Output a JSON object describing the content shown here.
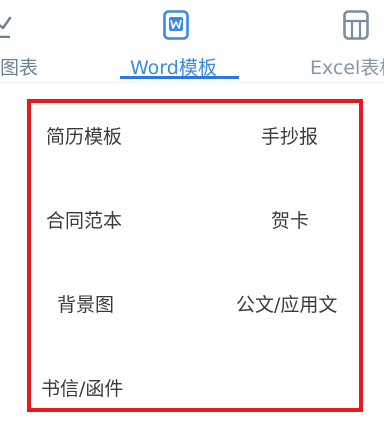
{
  "tabs": [
    {
      "id": "chart",
      "label": "图表",
      "icon": "chart-icon",
      "active": false
    },
    {
      "id": "word",
      "label": "Word模板",
      "icon": "word-icon",
      "active": true
    },
    {
      "id": "excel",
      "label": "Excel表格",
      "icon": "excel-icon",
      "active": false
    }
  ],
  "colors": {
    "active_tab": "#2b78e4",
    "highlight_border": "#e8191c",
    "item_text": "#3b3b3b",
    "inactive_tab": "#7b8c9e"
  },
  "categories": [
    "简历模板",
    "手抄报",
    "合同范本",
    "贺卡",
    "背景图",
    "公文/应用文",
    "书信/函件"
  ]
}
